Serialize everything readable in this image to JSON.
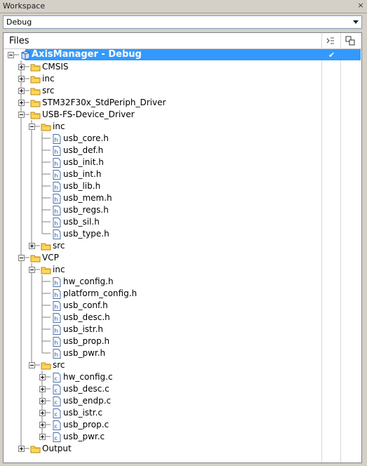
{
  "window": {
    "title": "Workspace",
    "close_label": "×"
  },
  "config": {
    "value": "Debug"
  },
  "panel": {
    "files_header": "Files",
    "check_mark": "✔"
  },
  "tree": [
    {
      "label": "AxisManager - Debug",
      "type": "project",
      "level": 0,
      "exp": "-"
    },
    {
      "label": "CMSIS",
      "type": "folder",
      "level": 1,
      "exp": "+"
    },
    {
      "label": "inc",
      "type": "folder",
      "level": 1,
      "exp": "+"
    },
    {
      "label": "src",
      "type": "folder",
      "level": 1,
      "exp": "+"
    },
    {
      "label": "STM32F30x_StdPeriph_Driver",
      "type": "folder",
      "level": 1,
      "exp": "+"
    },
    {
      "label": "USB-FS-Device_Driver",
      "type": "folder",
      "level": 1,
      "exp": "-"
    },
    {
      "label": "inc",
      "type": "folder",
      "level": 2,
      "exp": "-"
    },
    {
      "label": "usb_core.h",
      "type": "h",
      "level": 3
    },
    {
      "label": "usb_def.h",
      "type": "h",
      "level": 3
    },
    {
      "label": "usb_init.h",
      "type": "h",
      "level": 3
    },
    {
      "label": "usb_int.h",
      "type": "h",
      "level": 3
    },
    {
      "label": "usb_lib.h",
      "type": "h",
      "level": 3
    },
    {
      "label": "usb_mem.h",
      "type": "h",
      "level": 3
    },
    {
      "label": "usb_regs.h",
      "type": "h",
      "level": 3
    },
    {
      "label": "usb_sil.h",
      "type": "h",
      "level": 3
    },
    {
      "label": "usb_type.h",
      "type": "h",
      "level": 3
    },
    {
      "label": "src",
      "type": "folder",
      "level": 2,
      "exp": "+"
    },
    {
      "label": "VCP",
      "type": "folder",
      "level": 1,
      "exp": "-"
    },
    {
      "label": "inc",
      "type": "folder",
      "level": 2,
      "exp": "-"
    },
    {
      "label": "hw_config.h",
      "type": "h",
      "level": 3
    },
    {
      "label": "platform_config.h",
      "type": "h",
      "level": 3
    },
    {
      "label": "usb_conf.h",
      "type": "h",
      "level": 3
    },
    {
      "label": "usb_desc.h",
      "type": "h",
      "level": 3
    },
    {
      "label": "usb_istr.h",
      "type": "h",
      "level": 3
    },
    {
      "label": "usb_prop.h",
      "type": "h",
      "level": 3
    },
    {
      "label": "usb_pwr.h",
      "type": "h",
      "level": 3
    },
    {
      "label": "src",
      "type": "folder",
      "level": 2,
      "exp": "-"
    },
    {
      "label": "hw_config.c",
      "type": "c",
      "level": 3,
      "exp": "+"
    },
    {
      "label": "usb_desc.c",
      "type": "c",
      "level": 3,
      "exp": "+"
    },
    {
      "label": "usb_endp.c",
      "type": "c",
      "level": 3,
      "exp": "+"
    },
    {
      "label": "usb_istr.c",
      "type": "c",
      "level": 3,
      "exp": "+"
    },
    {
      "label": "usb_prop.c",
      "type": "c",
      "level": 3,
      "exp": "+"
    },
    {
      "label": "usb_pwr.c",
      "type": "c",
      "level": 3,
      "exp": "+"
    },
    {
      "label": "Output",
      "type": "folder",
      "level": 1,
      "exp": "+"
    }
  ]
}
